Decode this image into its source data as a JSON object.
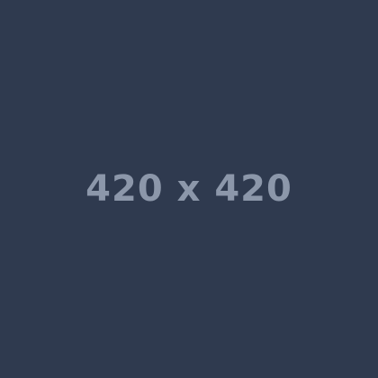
{
  "placeholder": {
    "label": "420 x 420",
    "background_color": "#2f3a4f",
    "text_color": "#8c97aa"
  }
}
